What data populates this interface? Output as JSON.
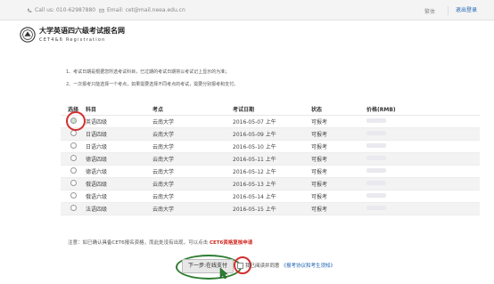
{
  "topbar": {
    "phone": "Call us: 010-62987880",
    "email": "Email: cet@mail.neea.edu.cn",
    "lang": "繁体",
    "login": "退出登录"
  },
  "header": {
    "title_cn": "大学英语四六级考试报名网",
    "title_en": "CET4&6 Registration"
  },
  "notes": [
    "1、考试日期是根据您所选考试科目，已过期的考试日期将以考试记上显示的为准；",
    "2、一次报考只能选择一个考点，如果需要选择不同考点的考试，需要分别报考和支付。"
  ],
  "table": {
    "headers": [
      "选择",
      "科目",
      "考点",
      "考试日期",
      "状态",
      "价格(RMB)"
    ],
    "rows": [
      {
        "subject": "英语四级",
        "site": "云南大学",
        "date": "2016-05-07 上午",
        "status": "可报考"
      },
      {
        "subject": "日语四级",
        "site": "云南大学",
        "date": "2016-05-09 上午",
        "status": "可报考"
      },
      {
        "subject": "日语六级",
        "site": "云南大学",
        "date": "2016-05-10 上午",
        "status": "可报考"
      },
      {
        "subject": "德语四级",
        "site": "云南大学",
        "date": "2016-05-11 上午",
        "status": "可报考"
      },
      {
        "subject": "德语六级",
        "site": "云南大学",
        "date": "2016-05-12 上午",
        "status": "可报考"
      },
      {
        "subject": "俄语四级",
        "site": "云南大学",
        "date": "2016-05-13 上午",
        "status": "可报考"
      },
      {
        "subject": "俄语六级",
        "site": "云南大学",
        "date": "2016-05-14 上午",
        "status": "可报考"
      },
      {
        "subject": "法语四级",
        "site": "云南大学",
        "date": "2016-05-15 上午",
        "status": "可报考"
      }
    ]
  },
  "notice": {
    "text": "注意：如已确认具备CET6报名资格，而此处没有出现，可以点击",
    "link": "CET6资格复核申请"
  },
  "actions": {
    "next_label": "下一步:在线支付",
    "agree_text": "我已阅读并同意",
    "agree_link": "《报考协议和考生须知》"
  }
}
